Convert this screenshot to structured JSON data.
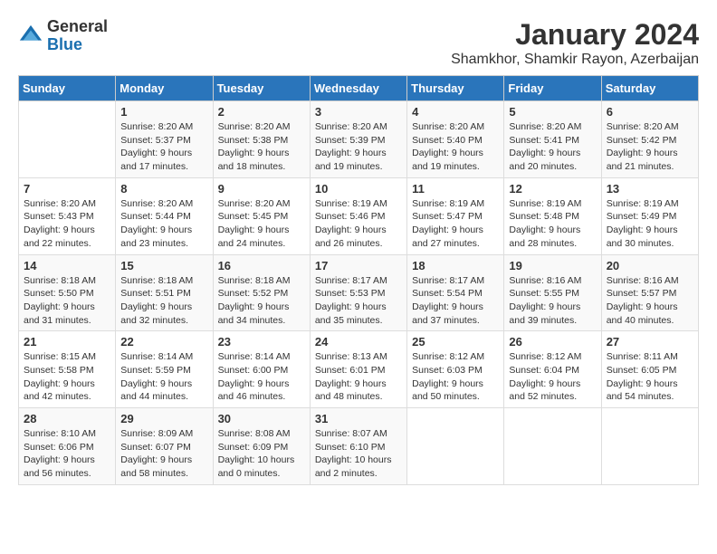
{
  "logo": {
    "general": "General",
    "blue": "Blue"
  },
  "title": "January 2024",
  "subtitle": "Shamkhor, Shamkir Rayon, Azerbaijan",
  "days_header": [
    "Sunday",
    "Monday",
    "Tuesday",
    "Wednesday",
    "Thursday",
    "Friday",
    "Saturday"
  ],
  "weeks": [
    [
      {
        "day": "",
        "sunrise": "",
        "sunset": "",
        "daylight": ""
      },
      {
        "day": "1",
        "sunrise": "Sunrise: 8:20 AM",
        "sunset": "Sunset: 5:37 PM",
        "daylight": "Daylight: 9 hours and 17 minutes."
      },
      {
        "day": "2",
        "sunrise": "Sunrise: 8:20 AM",
        "sunset": "Sunset: 5:38 PM",
        "daylight": "Daylight: 9 hours and 18 minutes."
      },
      {
        "day": "3",
        "sunrise": "Sunrise: 8:20 AM",
        "sunset": "Sunset: 5:39 PM",
        "daylight": "Daylight: 9 hours and 19 minutes."
      },
      {
        "day": "4",
        "sunrise": "Sunrise: 8:20 AM",
        "sunset": "Sunset: 5:40 PM",
        "daylight": "Daylight: 9 hours and 19 minutes."
      },
      {
        "day": "5",
        "sunrise": "Sunrise: 8:20 AM",
        "sunset": "Sunset: 5:41 PM",
        "daylight": "Daylight: 9 hours and 20 minutes."
      },
      {
        "day": "6",
        "sunrise": "Sunrise: 8:20 AM",
        "sunset": "Sunset: 5:42 PM",
        "daylight": "Daylight: 9 hours and 21 minutes."
      }
    ],
    [
      {
        "day": "7",
        "sunrise": "Sunrise: 8:20 AM",
        "sunset": "Sunset: 5:43 PM",
        "daylight": "Daylight: 9 hours and 22 minutes."
      },
      {
        "day": "8",
        "sunrise": "Sunrise: 8:20 AM",
        "sunset": "Sunset: 5:44 PM",
        "daylight": "Daylight: 9 hours and 23 minutes."
      },
      {
        "day": "9",
        "sunrise": "Sunrise: 8:20 AM",
        "sunset": "Sunset: 5:45 PM",
        "daylight": "Daylight: 9 hours and 24 minutes."
      },
      {
        "day": "10",
        "sunrise": "Sunrise: 8:19 AM",
        "sunset": "Sunset: 5:46 PM",
        "daylight": "Daylight: 9 hours and 26 minutes."
      },
      {
        "day": "11",
        "sunrise": "Sunrise: 8:19 AM",
        "sunset": "Sunset: 5:47 PM",
        "daylight": "Daylight: 9 hours and 27 minutes."
      },
      {
        "day": "12",
        "sunrise": "Sunrise: 8:19 AM",
        "sunset": "Sunset: 5:48 PM",
        "daylight": "Daylight: 9 hours and 28 minutes."
      },
      {
        "day": "13",
        "sunrise": "Sunrise: 8:19 AM",
        "sunset": "Sunset: 5:49 PM",
        "daylight": "Daylight: 9 hours and 30 minutes."
      }
    ],
    [
      {
        "day": "14",
        "sunrise": "Sunrise: 8:18 AM",
        "sunset": "Sunset: 5:50 PM",
        "daylight": "Daylight: 9 hours and 31 minutes."
      },
      {
        "day": "15",
        "sunrise": "Sunrise: 8:18 AM",
        "sunset": "Sunset: 5:51 PM",
        "daylight": "Daylight: 9 hours and 32 minutes."
      },
      {
        "day": "16",
        "sunrise": "Sunrise: 8:18 AM",
        "sunset": "Sunset: 5:52 PM",
        "daylight": "Daylight: 9 hours and 34 minutes."
      },
      {
        "day": "17",
        "sunrise": "Sunrise: 8:17 AM",
        "sunset": "Sunset: 5:53 PM",
        "daylight": "Daylight: 9 hours and 35 minutes."
      },
      {
        "day": "18",
        "sunrise": "Sunrise: 8:17 AM",
        "sunset": "Sunset: 5:54 PM",
        "daylight": "Daylight: 9 hours and 37 minutes."
      },
      {
        "day": "19",
        "sunrise": "Sunrise: 8:16 AM",
        "sunset": "Sunset: 5:55 PM",
        "daylight": "Daylight: 9 hours and 39 minutes."
      },
      {
        "day": "20",
        "sunrise": "Sunrise: 8:16 AM",
        "sunset": "Sunset: 5:57 PM",
        "daylight": "Daylight: 9 hours and 40 minutes."
      }
    ],
    [
      {
        "day": "21",
        "sunrise": "Sunrise: 8:15 AM",
        "sunset": "Sunset: 5:58 PM",
        "daylight": "Daylight: 9 hours and 42 minutes."
      },
      {
        "day": "22",
        "sunrise": "Sunrise: 8:14 AM",
        "sunset": "Sunset: 5:59 PM",
        "daylight": "Daylight: 9 hours and 44 minutes."
      },
      {
        "day": "23",
        "sunrise": "Sunrise: 8:14 AM",
        "sunset": "Sunset: 6:00 PM",
        "daylight": "Daylight: 9 hours and 46 minutes."
      },
      {
        "day": "24",
        "sunrise": "Sunrise: 8:13 AM",
        "sunset": "Sunset: 6:01 PM",
        "daylight": "Daylight: 9 hours and 48 minutes."
      },
      {
        "day": "25",
        "sunrise": "Sunrise: 8:12 AM",
        "sunset": "Sunset: 6:03 PM",
        "daylight": "Daylight: 9 hours and 50 minutes."
      },
      {
        "day": "26",
        "sunrise": "Sunrise: 8:12 AM",
        "sunset": "Sunset: 6:04 PM",
        "daylight": "Daylight: 9 hours and 52 minutes."
      },
      {
        "day": "27",
        "sunrise": "Sunrise: 8:11 AM",
        "sunset": "Sunset: 6:05 PM",
        "daylight": "Daylight: 9 hours and 54 minutes."
      }
    ],
    [
      {
        "day": "28",
        "sunrise": "Sunrise: 8:10 AM",
        "sunset": "Sunset: 6:06 PM",
        "daylight": "Daylight: 9 hours and 56 minutes."
      },
      {
        "day": "29",
        "sunrise": "Sunrise: 8:09 AM",
        "sunset": "Sunset: 6:07 PM",
        "daylight": "Daylight: 9 hours and 58 minutes."
      },
      {
        "day": "30",
        "sunrise": "Sunrise: 8:08 AM",
        "sunset": "Sunset: 6:09 PM",
        "daylight": "Daylight: 10 hours and 0 minutes."
      },
      {
        "day": "31",
        "sunrise": "Sunrise: 8:07 AM",
        "sunset": "Sunset: 6:10 PM",
        "daylight": "Daylight: 10 hours and 2 minutes."
      },
      {
        "day": "",
        "sunrise": "",
        "sunset": "",
        "daylight": ""
      },
      {
        "day": "",
        "sunrise": "",
        "sunset": "",
        "daylight": ""
      },
      {
        "day": "",
        "sunrise": "",
        "sunset": "",
        "daylight": ""
      }
    ]
  ]
}
